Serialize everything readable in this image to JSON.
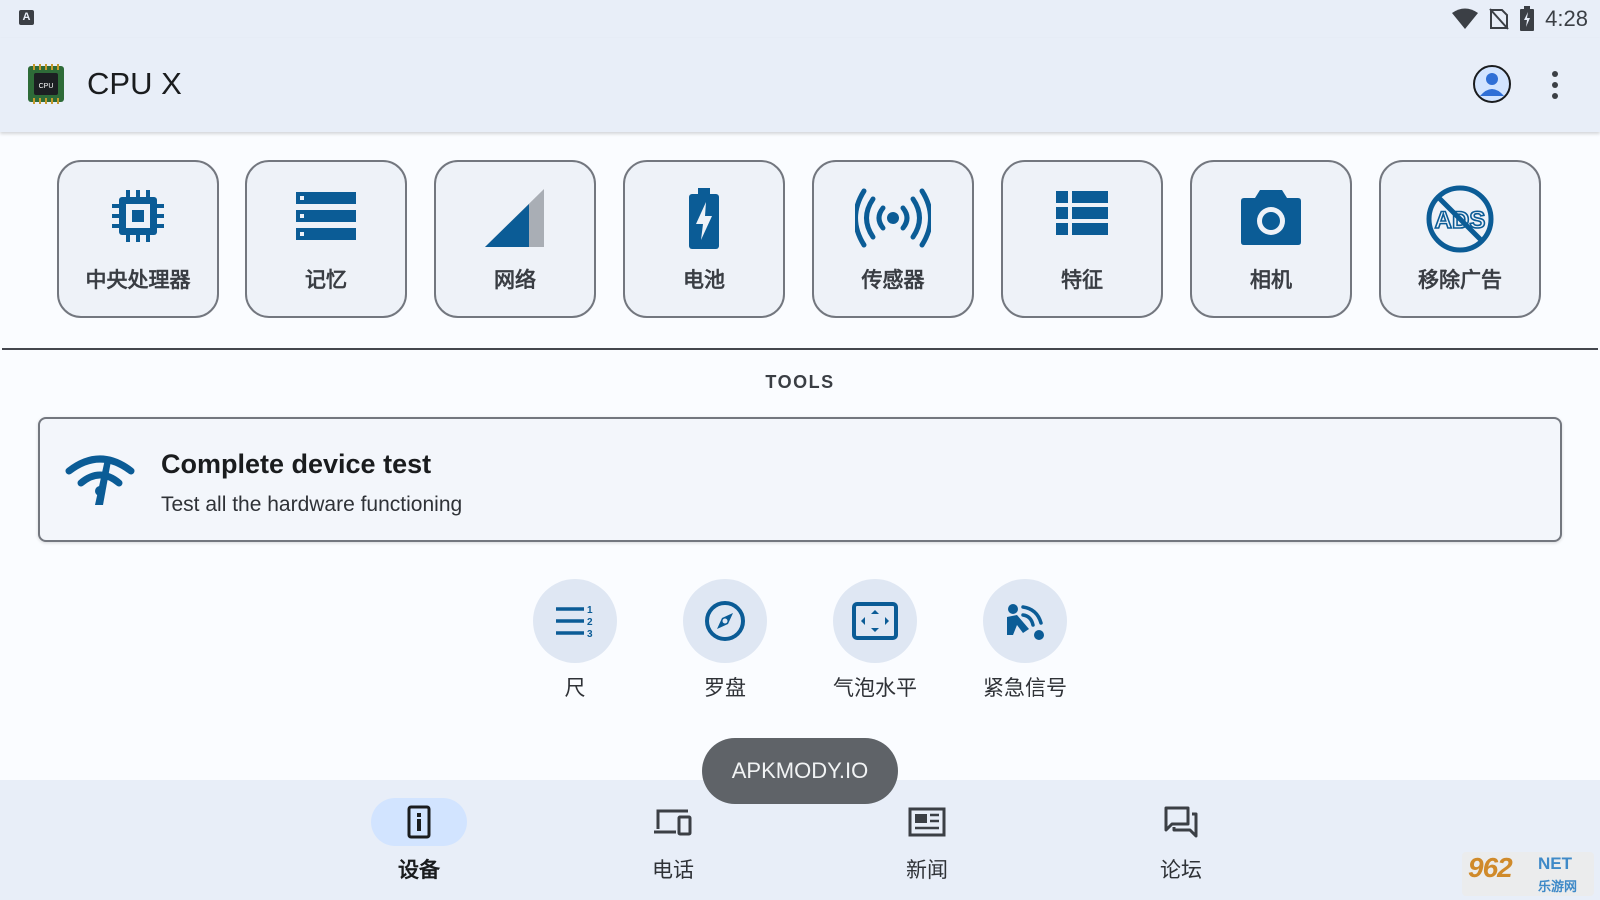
{
  "status_bar": {
    "left_icon": "A",
    "time": "4:28",
    "icons": [
      "wifi-icon",
      "no-sim-icon",
      "battery-charging-icon"
    ]
  },
  "app_bar": {
    "title": "CPU X",
    "logo_text": "CPU",
    "icons": [
      "account-icon",
      "more-vert-icon"
    ]
  },
  "categories": [
    {
      "label": "中央处理器",
      "icon": "cpu-chip-icon"
    },
    {
      "label": "记忆",
      "icon": "memory-storage-icon"
    },
    {
      "label": "网络",
      "icon": "network-signal-icon"
    },
    {
      "label": "电池",
      "icon": "battery-icon"
    },
    {
      "label": "传感器",
      "icon": "sensors-icon"
    },
    {
      "label": "特征",
      "icon": "features-list-icon"
    },
    {
      "label": "相机",
      "icon": "camera-icon"
    },
    {
      "label": "移除广告",
      "icon": "remove-ads-icon"
    }
  ],
  "tools": {
    "title": "TOOLS",
    "device_test": {
      "title": "Complete device test",
      "subtitle": "Test all the hardware functioning",
      "icon": "device-test-icon"
    },
    "items": [
      {
        "label": "尺",
        "icon": "ruler-icon"
      },
      {
        "label": "罗盘",
        "icon": "compass-icon"
      },
      {
        "label": "气泡水平",
        "icon": "bubble-level-icon"
      },
      {
        "label": "紧急信号",
        "icon": "emergency-signal-icon"
      }
    ]
  },
  "toast": "APKMODY.IO",
  "bottom_nav": [
    {
      "label": "设备",
      "icon": "device-info-icon",
      "active": true
    },
    {
      "label": "电话",
      "icon": "devices-icon",
      "active": false
    },
    {
      "label": "新闻",
      "icon": "news-icon",
      "active": false
    },
    {
      "label": "论坛",
      "icon": "forum-icon",
      "active": false
    }
  ],
  "watermark": {
    "main": "962",
    "net": "NET",
    "sub": "乐游网"
  },
  "colors": {
    "accent": "#0b5c96",
    "surface": "#e8eef8",
    "background": "#fafcff",
    "active_pill": "#d2e4ff",
    "toast_bg": "#5f6368"
  }
}
